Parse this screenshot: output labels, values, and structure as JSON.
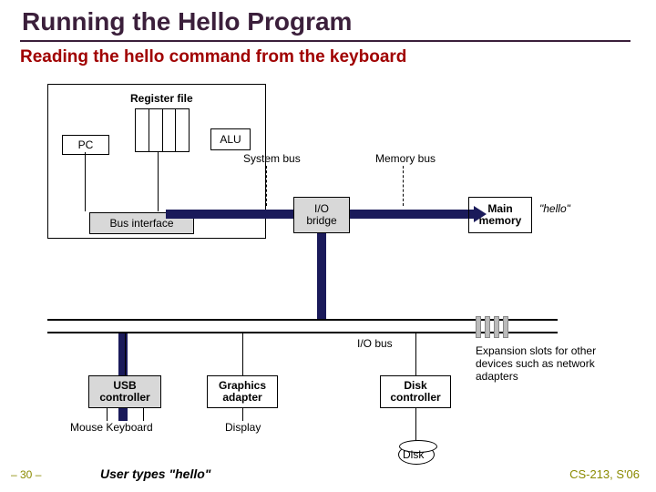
{
  "title": "Running the Hello Program",
  "subtitle": "Reading the hello command from the keyboard",
  "cpu": {
    "register_file_label": "Register file",
    "pc": "PC",
    "alu": "ALU",
    "bus_interface": "Bus interface"
  },
  "buses": {
    "system_bus": "System bus",
    "memory_bus": "Memory bus",
    "io_bus": "I/O bus"
  },
  "io_bridge": "I/O\nbridge",
  "main_memory": "Main\nmemory",
  "hello_text": "\"hello\"",
  "controllers": {
    "usb": "USB\ncontroller",
    "graphics": "Graphics\nadapter",
    "disk": "Disk\ncontroller"
  },
  "peripherals": {
    "mouse_keyboard": "Mouse Keyboard",
    "display": "Display",
    "disk": "Disk"
  },
  "expansion_label": "Expansion slots for other devices such as network adapters",
  "caption": "User types \"hello\"",
  "page_number": "– 30 –",
  "footer_right": "CS-213, S'06"
}
